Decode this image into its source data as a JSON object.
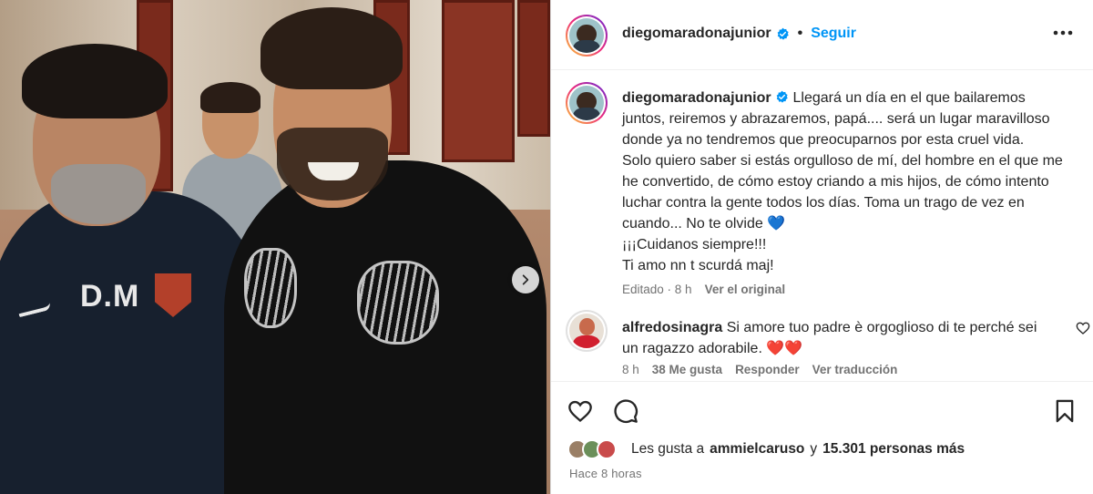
{
  "post": {
    "username": "diegomaradonajunior",
    "follow_label": "Seguir",
    "dot": "•",
    "jersey_text": "D.M",
    "caption_user": "diegomaradonajunior",
    "caption": "Llegará un día en el que bailaremos juntos, reiremos y abrazaremos, papá.... será un lugar maravilloso donde ya no tendremos que preocuparnos por esta cruel vida.\nSolo quiero saber si estás orgulloso de mí, del hombre en el que me he convertido, de cómo estoy criando a mis hijos, de cómo intento luchar contra la gente todos los días. Toma un trago de vez en cuando... No te olvide 💙\n¡¡¡Cuidanos siempre!!!\nTi amo nn t scurdá maj!",
    "caption_meta": {
      "edited": "Editado · 8 h",
      "see_original": "Ver el original"
    }
  },
  "comment": {
    "username": "alfredosinagra",
    "text": "Si amore tuo padre è orgoglioso di te perché sei un ragazzo adorabile. ❤️❤️",
    "time": "8 h",
    "likes": "38 Me gusta",
    "reply": "Responder",
    "translate": "Ver traducción"
  },
  "likes": {
    "prefix": "Les gusta a",
    "user": "ammielcaruso",
    "connector": "y",
    "others": "15.301 personas más"
  },
  "timestamp": "Hace 8 horas",
  "colors": {
    "accent": "#0095f6",
    "verified": "#0095f6",
    "muted": "#737373",
    "text": "#262626"
  },
  "icons": [
    "chevron-right-icon",
    "verified-badge-icon",
    "more-options-icon",
    "heart-icon",
    "comment-icon",
    "bookmark-icon"
  ]
}
